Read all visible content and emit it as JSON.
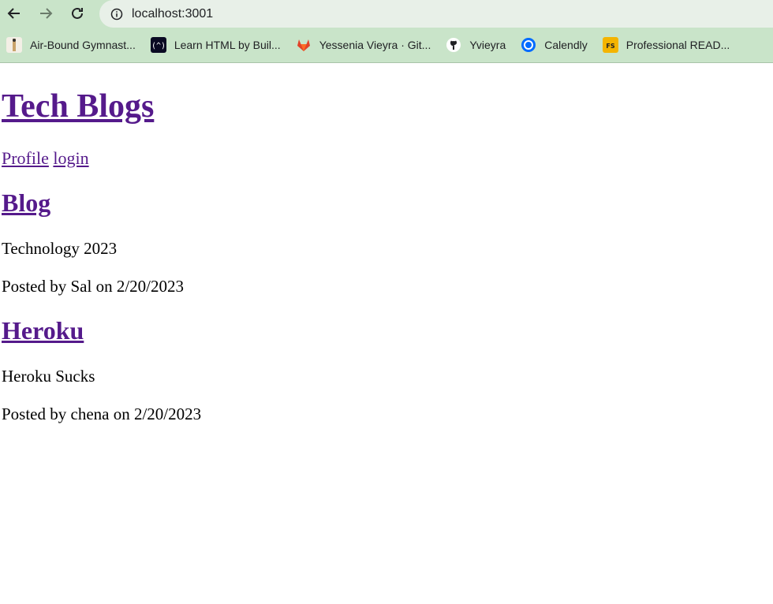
{
  "browser": {
    "url": "localhost:3001",
    "bookmarks": [
      {
        "label": "Air-Bound Gymnast...",
        "icon": "gymnast-icon"
      },
      {
        "label": "Learn HTML by Buil...",
        "icon": "freecodecamp-icon"
      },
      {
        "label": "Yessenia Vieyra · Git...",
        "icon": "gitlab-icon"
      },
      {
        "label": "Yvieyra",
        "icon": "github-icon"
      },
      {
        "label": "Calendly",
        "icon": "calendly-icon"
      },
      {
        "label": "Professional READ...",
        "icon": "fs-icon"
      }
    ]
  },
  "page": {
    "title": "Tech Blogs",
    "nav": {
      "profile": "Profile",
      "login": "login"
    },
    "posts": [
      {
        "title": "Blog",
        "body": "Technology 2023",
        "meta": "Posted by Sal on 2/20/2023"
      },
      {
        "title": "Heroku",
        "body": "Heroku Sucks",
        "meta": "Posted by chena on 2/20/2023"
      }
    ]
  },
  "colors": {
    "chrome": "#c9e4c9",
    "link": "#551a8b"
  }
}
